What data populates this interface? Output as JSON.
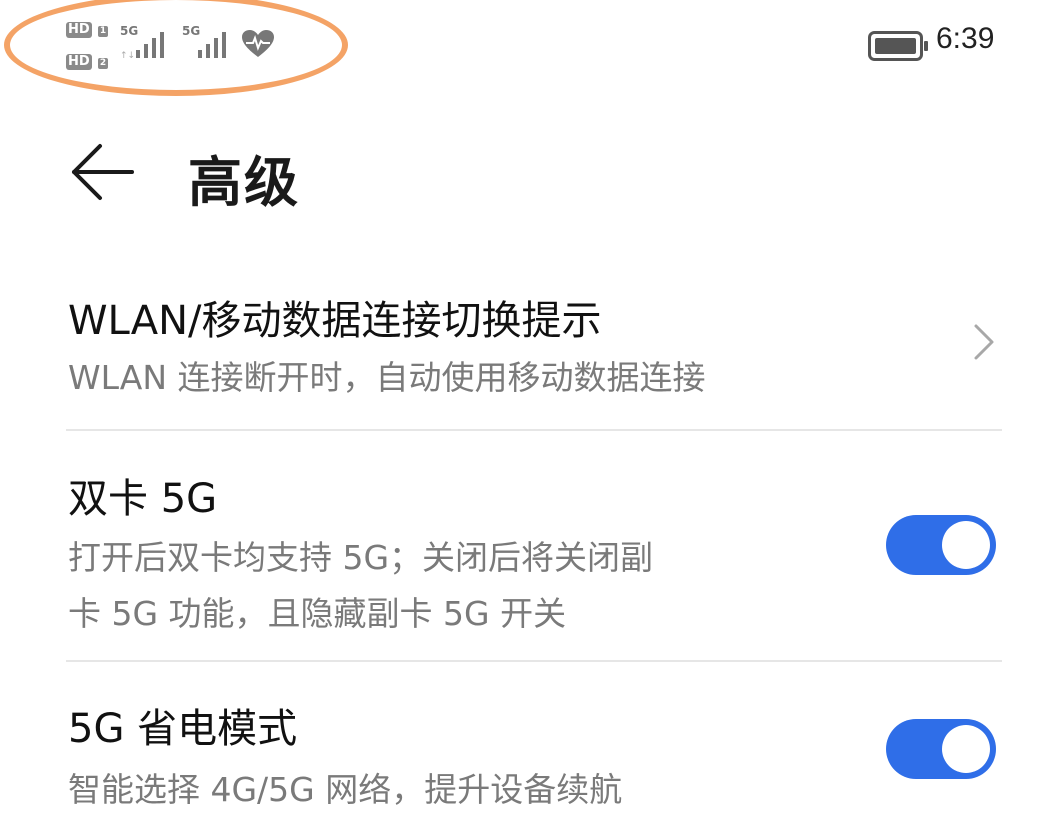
{
  "status_bar": {
    "hd_badge": "HD",
    "sim1_index": "1",
    "sim2_index": "2",
    "sim1_network": "5G",
    "sim2_network": "5G",
    "time": "6:39",
    "icons": [
      "hd-icon",
      "signal-icon",
      "heart-health-icon",
      "battery-icon"
    ]
  },
  "header": {
    "title": "高级"
  },
  "settings": [
    {
      "title": "WLAN/移动数据连接切换提示",
      "subtitle": "WLAN 连接断开时，自动使用移动数据连接",
      "control": "chevron"
    },
    {
      "title": "双卡 5G",
      "subtitle_line1": "打开后双卡均支持 5G；关闭后将关闭副",
      "subtitle_line2": "卡 5G 功能，且隐藏副卡 5G 开关",
      "control": "toggle",
      "enabled": true
    },
    {
      "title": "5G 省电模式",
      "subtitle": "智能选择 4G/5G 网络，提升设备续航",
      "control": "toggle",
      "enabled": true
    }
  ],
  "colors": {
    "accent": "#2f6ee8",
    "highlight": "#f4a366",
    "subtitle": "#7a7a7a",
    "divider": "#e6e6e6"
  }
}
